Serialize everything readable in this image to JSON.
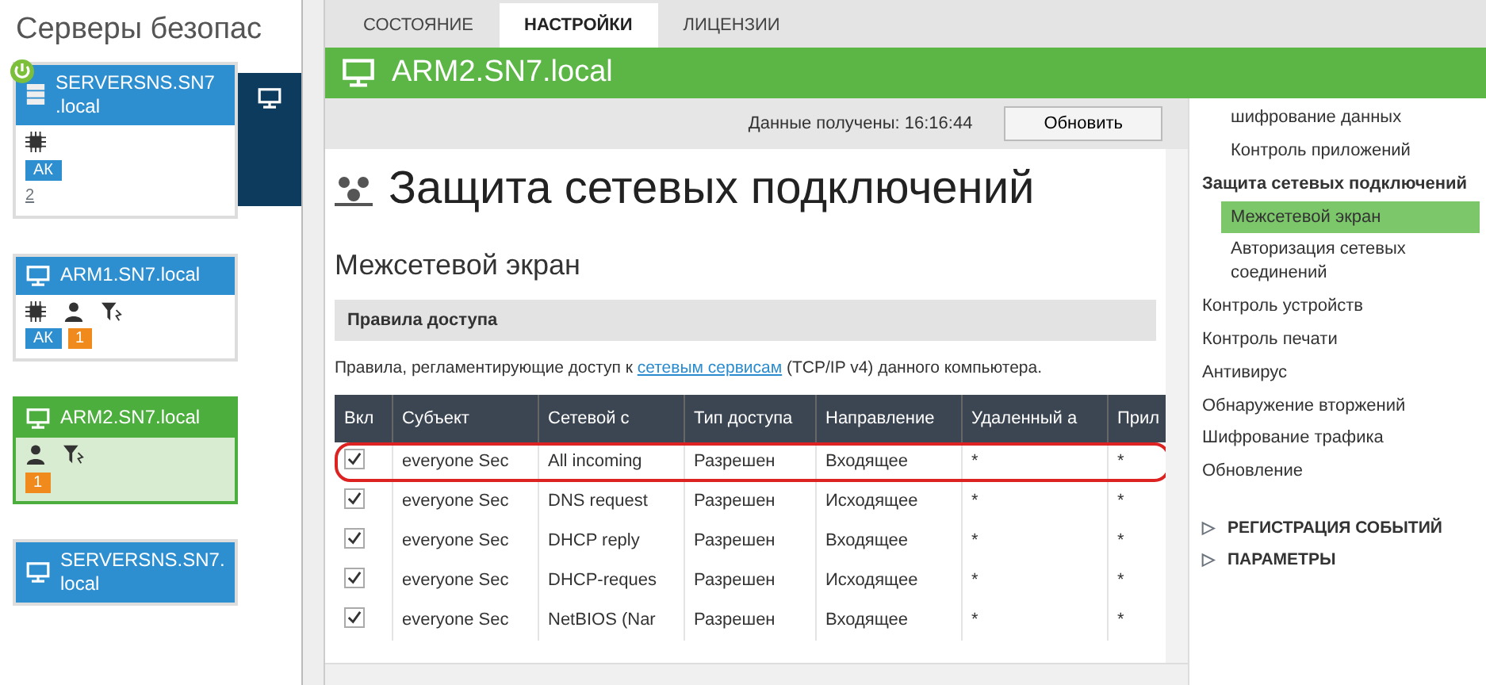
{
  "servers_pane": {
    "title": "Серверы безопас",
    "cards": [
      {
        "kind": "server",
        "name": "SERVERSNS.SN7 .local",
        "selected": false,
        "icons": [
          {
            "kind": "chip"
          }
        ],
        "badges": [
          {
            "text": "АК",
            "color": "#2e8fd0"
          }
        ],
        "link": "2"
      },
      {
        "kind": "host",
        "name": "ARM1.SN7.local",
        "selected": false,
        "icons": [
          {
            "kind": "chip"
          },
          {
            "kind": "user"
          },
          {
            "kind": "filter"
          }
        ],
        "badges": [
          {
            "text": "АК",
            "color": "#2e8fd0"
          },
          {
            "text": "1",
            "color": "#f08a1c"
          }
        ]
      },
      {
        "kind": "host",
        "name": "ARM2.SN7.local",
        "selected": true,
        "icons": [
          {
            "kind": "user"
          },
          {
            "kind": "filter"
          }
        ],
        "badges": [
          {
            "text": "1",
            "color": "#f08a1c"
          }
        ]
      },
      {
        "kind": "host",
        "name": "SERVERSNS.SN7. local",
        "selected": false
      }
    ]
  },
  "tabs": [
    {
      "label": "СОСТОЯНИЕ",
      "selected": false
    },
    {
      "label": "НАСТРОЙКИ",
      "selected": true
    },
    {
      "label": "ЛИЦЕНЗИИ",
      "selected": false
    }
  ],
  "header": {
    "title": "ARM2.SN7.local"
  },
  "info_bar": {
    "label": "Данные получены:",
    "time": "16:16:44",
    "button": "Обновить"
  },
  "page": {
    "title": "Защита сетевых подключений",
    "subtitle": "Межсетевой экран",
    "section": "Правила доступа",
    "description_before": "Правила, регламентирующие доступ к",
    "description_link": "сетевым сервисам",
    "description_after": "(TCP/IP v4) данного компьютера."
  },
  "table": {
    "columns": [
      "Вкл",
      "Субъект",
      "Сетевой с",
      "Тип доступа",
      "Направление",
      "Удаленный а",
      "Прил"
    ],
    "rows": [
      {
        "checked": true,
        "circled": true,
        "cells": [
          "",
          "everyone Sec",
          "All incoming",
          "Разрешен",
          "Входящее",
          "*",
          "*"
        ]
      },
      {
        "checked": true,
        "circled": false,
        "cells": [
          "",
          "everyone Sec",
          "DNS request",
          "Разрешен",
          "Исходящее",
          "*",
          "*"
        ]
      },
      {
        "checked": true,
        "circled": false,
        "cells": [
          "",
          "everyone Sec",
          "DHCP reply",
          "Разрешен",
          "Входящее",
          "*",
          "*"
        ]
      },
      {
        "checked": true,
        "circled": false,
        "cells": [
          "",
          "everyone Sec",
          "DHCP-reques",
          "Разрешен",
          "Исходящее",
          "*",
          "*"
        ]
      },
      {
        "checked": true,
        "circled": false,
        "cells": [
          "",
          "everyone Sec",
          "NetBIOS (Nar",
          "Разрешен",
          "Входящее",
          "*",
          "*"
        ]
      }
    ]
  },
  "settings_nav": {
    "items": [
      {
        "children": [
          {
            "label": "шифрование данных",
            "selected": false
          },
          {
            "label": "Контроль приложений",
            "selected": false
          }
        ]
      },
      {
        "label": "Защита сетевых подключений",
        "selected": false,
        "children": [
          {
            "label": "Межсетевой экран",
            "selected": true
          },
          {
            "label": "Авторизация сетевых соединений",
            "selected": false
          }
        ]
      },
      {
        "label": "Контроль устройств",
        "selected": false
      },
      {
        "label": "Контроль печати",
        "selected": false
      },
      {
        "label": "Антивирус",
        "selected": false
      },
      {
        "label": "Обнаружение вторжений",
        "selected": false
      },
      {
        "label": "Шифрование трафика",
        "selected": false
      },
      {
        "label": "Обновление",
        "selected": false
      }
    ],
    "sections": [
      {
        "arrow": "▷",
        "label": "РЕГИСТРАЦИЯ СОБЫТИЙ"
      },
      {
        "arrow": "▷",
        "label": "ПАРАМЕТРЫ"
      }
    ]
  }
}
